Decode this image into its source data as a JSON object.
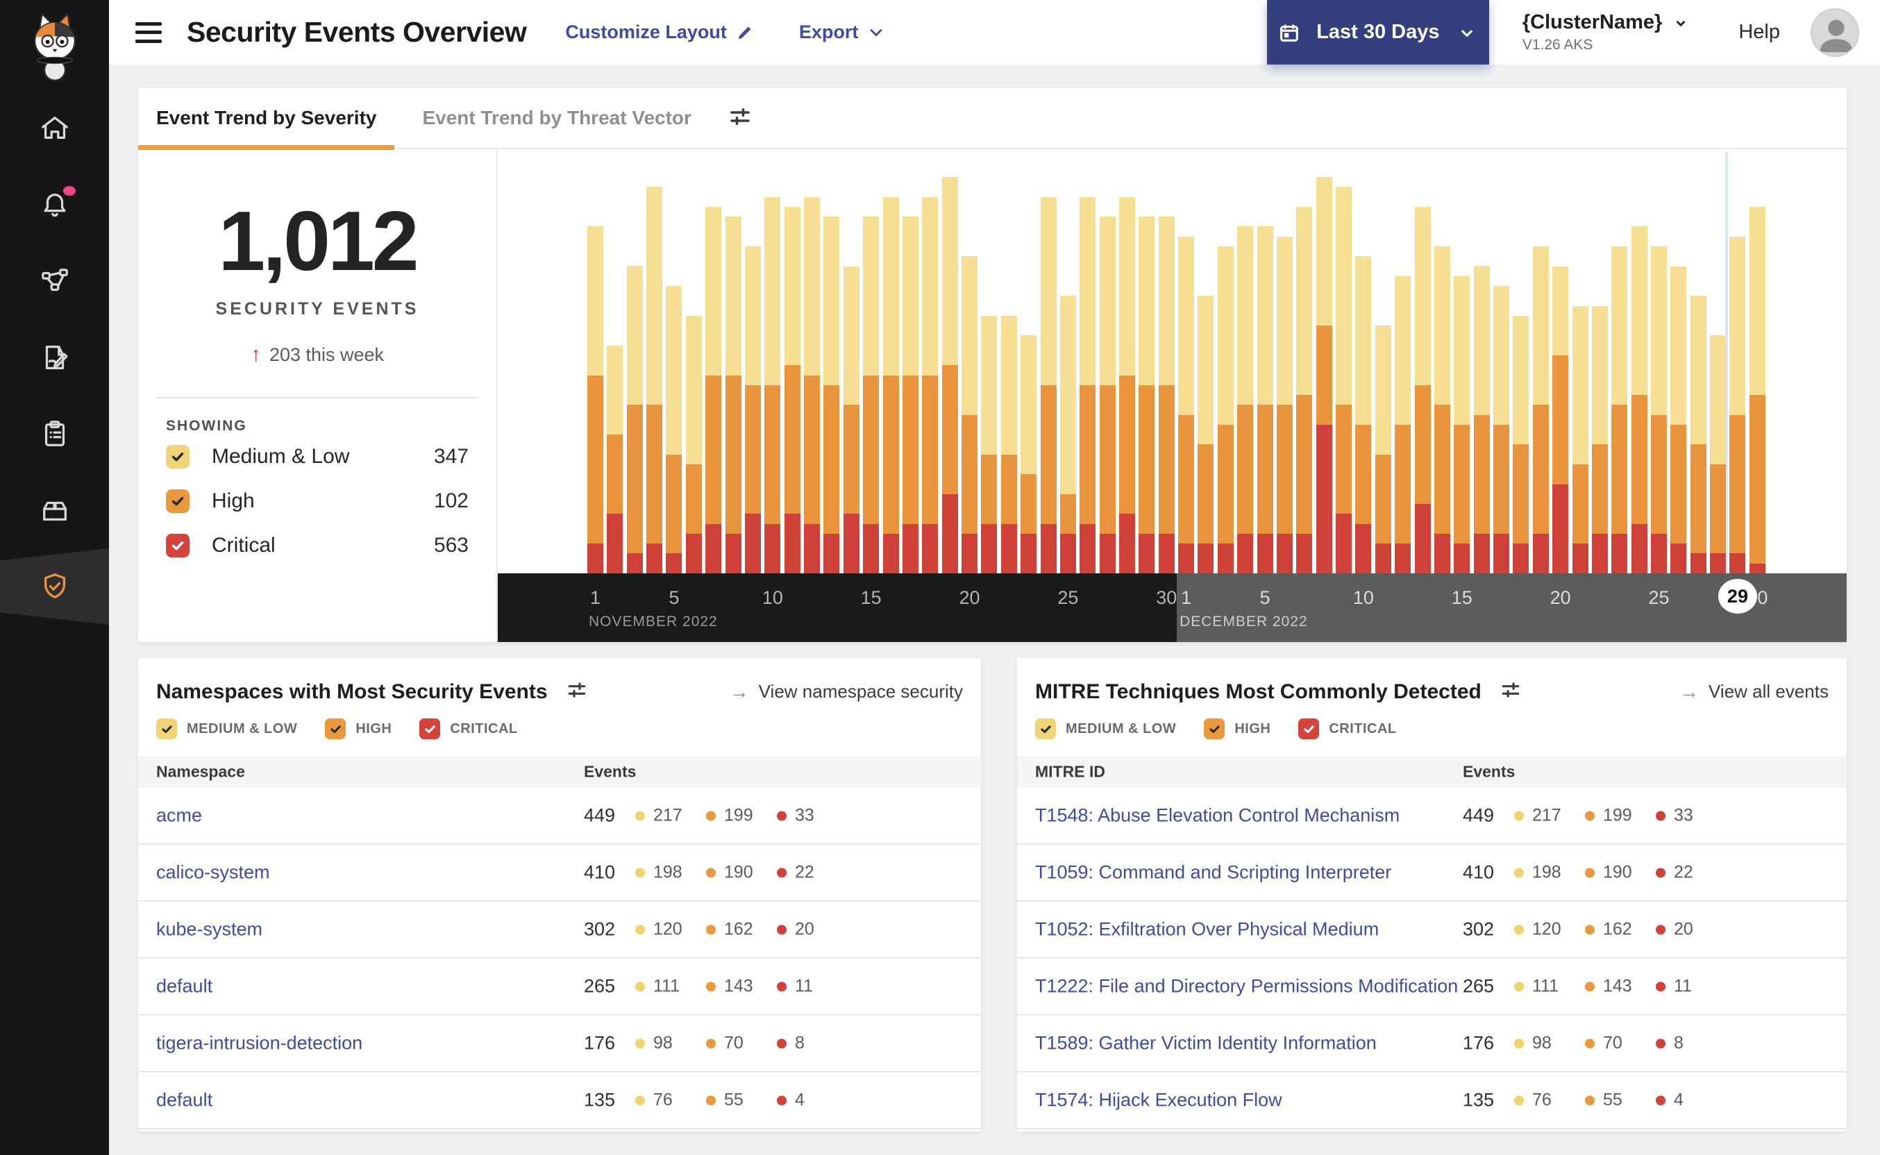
{
  "app": {
    "title": "Security Events Overview",
    "customize_layout_label": "Customize Layout",
    "export_label": "Export",
    "date_range_label": "Last 30 Days",
    "cluster_name": "{ClusterName}",
    "cluster_version": "V1.26 AKS",
    "help_label": "Help"
  },
  "colors": {
    "accent_orange": "#f49b33",
    "button_indigo": "#333f7f",
    "link_indigo": "#3d4ba5",
    "severity_yellow": "#f2d478",
    "severity_orange": "#eb993d",
    "severity_red": "#d6423c",
    "axis_november": "#1a1a1a",
    "axis_december": "#5c5c5c",
    "highlight_line": "#d6eaf6"
  },
  "sidebar": {
    "items": [
      {
        "icon": "home-icon"
      },
      {
        "icon": "bell-icon",
        "badge": true
      },
      {
        "icon": "service-graph-icon"
      },
      {
        "icon": "report-edit-icon"
      },
      {
        "icon": "clipboard-icon"
      },
      {
        "icon": "box-icon"
      },
      {
        "icon": "shield-check-icon",
        "active": true
      }
    ]
  },
  "severity_filters": [
    {
      "label": "MEDIUM & LOW",
      "color": "#f2d478",
      "check": "#2b2b2b",
      "checked": true
    },
    {
      "label": "HIGH",
      "color": "#eb993d",
      "check": "#2b2b2b",
      "checked": true
    },
    {
      "label": "CRITICAL",
      "color": "#d6423c",
      "check": "#ffffff",
      "checked": true
    }
  ],
  "trend_card": {
    "tabs": [
      {
        "label": "Event Trend by Severity",
        "active": true
      },
      {
        "label": "Event Trend by Threat Vector",
        "active": false
      }
    ],
    "summary": {
      "total": "1,012",
      "label": "SECURITY EVENTS",
      "delta_arrow": "↑",
      "delta_text": "203 this week"
    },
    "showing_label": "SHOWING",
    "showing": [
      {
        "label": "Medium & Low",
        "count": "347",
        "color": "#f2d478",
        "check": "#2b2b2b",
        "checked": true
      },
      {
        "label": "High",
        "count": "102",
        "color": "#eb993d",
        "check": "#2b2b2b",
        "checked": true
      },
      {
        "label": "Critical",
        "count": "563",
        "color": "#d6423c",
        "check": "#ffffff",
        "checked": true
      }
    ]
  },
  "chart_data": {
    "type": "bar",
    "stacked": true,
    "title": "Event Trend by Severity",
    "legend_position": "none",
    "grid": false,
    "y_max": 40,
    "months": [
      {
        "label": "NOVEMBER 2022",
        "days": 30
      },
      {
        "label": "DECEMBER 2022",
        "days": 30
      }
    ],
    "ticks": [
      1,
      5,
      10,
      15,
      20,
      25,
      30
    ],
    "highlight": {
      "month_index": 1,
      "day": 29
    },
    "series": [
      {
        "name": "Critical",
        "color": "#cf4138",
        "values": [
          3,
          6,
          2,
          3,
          2,
          4,
          5,
          4,
          6,
          5,
          6,
          5,
          4,
          6,
          5,
          4,
          5,
          5,
          8,
          4,
          5,
          5,
          4,
          5,
          4,
          5,
          4,
          6,
          4,
          4,
          3,
          3,
          3,
          4,
          4,
          4,
          4,
          15,
          6,
          5,
          3,
          3,
          7,
          4,
          3,
          4,
          4,
          3,
          4,
          9,
          3,
          4,
          4,
          5,
          4,
          3,
          2,
          2,
          2,
          1
        ]
      },
      {
        "name": "High",
        "color": "#e9953e",
        "values": [
          17,
          8,
          15,
          14,
          10,
          7,
          15,
          16,
          13,
          14,
          15,
          15,
          15,
          11,
          15,
          16,
          15,
          15,
          13,
          12,
          7,
          7,
          6,
          14,
          4,
          14,
          15,
          14,
          15,
          15,
          13,
          10,
          12,
          13,
          13,
          13,
          14,
          10,
          11,
          10,
          9,
          12,
          12,
          13,
          12,
          12,
          11,
          10,
          13,
          13,
          8,
          9,
          13,
          13,
          12,
          12,
          11,
          9,
          14,
          17
        ]
      },
      {
        "name": "Medium & Low",
        "color": "#f6df93",
        "values": [
          15,
          9,
          14,
          22,
          17,
          15,
          17,
          16,
          14,
          19,
          16,
          18,
          17,
          14,
          16,
          18,
          16,
          18,
          19,
          16,
          14,
          14,
          14,
          19,
          20,
          19,
          17,
          18,
          17,
          17,
          18,
          15,
          18,
          18,
          18,
          17,
          19,
          15,
          22,
          17,
          13,
          15,
          18,
          16,
          15,
          15,
          14,
          13,
          16,
          9,
          16,
          14,
          16,
          17,
          17,
          16,
          15,
          13,
          18,
          19
        ]
      }
    ]
  },
  "panels": [
    {
      "title": "Namespaces with Most Security Events",
      "link": "View namespace security",
      "link_arrow": "→",
      "columns": [
        "Namespace",
        "Events"
      ],
      "rows": [
        {
          "name": "acme",
          "total": "449",
          "medium_low": "217",
          "high": "199",
          "critical": "33"
        },
        {
          "name": "calico-system",
          "total": "410",
          "medium_low": "198",
          "high": "190",
          "critical": "22"
        },
        {
          "name": "kube-system",
          "total": "302",
          "medium_low": "120",
          "high": "162",
          "critical": "20"
        },
        {
          "name": "default",
          "total": "265",
          "medium_low": "111",
          "high": "143",
          "critical": "11"
        },
        {
          "name": "tigera-intrusion-detection",
          "total": "176",
          "medium_low": "98",
          "high": "70",
          "critical": "8"
        },
        {
          "name": "default",
          "total": "135",
          "medium_low": "76",
          "high": "55",
          "critical": "4"
        }
      ]
    },
    {
      "title": "MITRE Techniques Most Commonly Detected",
      "link": "View all events",
      "link_arrow": "→",
      "columns": [
        "MITRE ID",
        "Events"
      ],
      "rows": [
        {
          "name": "T1548: Abuse Elevation Control Mechanism",
          "total": "449",
          "medium_low": "217",
          "high": "199",
          "critical": "33"
        },
        {
          "name": "T1059: Command and Scripting Interpreter",
          "total": "410",
          "medium_low": "198",
          "high": "190",
          "critical": "22"
        },
        {
          "name": "T1052: Exfiltration Over Physical Medium",
          "total": "302",
          "medium_low": "120",
          "high": "162",
          "critical": "20"
        },
        {
          "name": "T1222: File and Directory Permissions Modification",
          "total": "265",
          "medium_low": "111",
          "high": "143",
          "critical": "11"
        },
        {
          "name": "T1589: Gather Victim Identity Information",
          "total": "176",
          "medium_low": "98",
          "high": "70",
          "critical": "8"
        },
        {
          "name": "T1574: Hijack Execution Flow",
          "total": "135",
          "medium_low": "76",
          "high": "55",
          "critical": "4"
        }
      ]
    }
  ]
}
